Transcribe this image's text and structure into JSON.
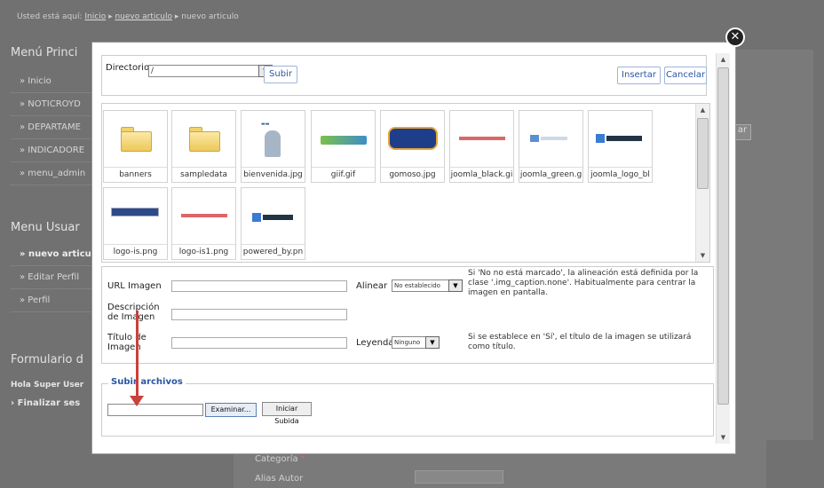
{
  "breadcrumb": {
    "prefix": "Usted está aquí:",
    "items": [
      "Inicio",
      "nuevo articulo",
      "nuevo articulo"
    ]
  },
  "sidebar": {
    "menu_principal": {
      "title": "Menú Princi",
      "items": [
        "Inicio",
        "NOTICROYD",
        "DEPARTAME",
        "INDICADORE",
        "menu_admin"
      ]
    },
    "menu_usuario": {
      "title": "Menu Usuar",
      "items": [
        "nuevo articu",
        "Editar Perfil",
        "Perfil"
      ]
    },
    "formulario": {
      "title": "Formulario d",
      "greeting": "Hola Super User",
      "logout": "Finalizar ses"
    }
  },
  "background_form": {
    "categoria_label": "Categoría",
    "required_mark": "*",
    "alias_label": "Alias Autor",
    "button_partial": "ar"
  },
  "modal": {
    "close_icon": "close-icon",
    "toolbar": {
      "directorio_label": "Directorio",
      "directorio_value": "/",
      "subir_label": "Subir",
      "insertar_label": "Insertar",
      "cancelar_label": "Cancelar"
    },
    "files": [
      {
        "name": "banners",
        "type": "folder"
      },
      {
        "name": "sampledata",
        "type": "folder"
      },
      {
        "name": "bienvenida.jpg",
        "type": "image"
      },
      {
        "name": "giif.gif",
        "type": "image"
      },
      {
        "name": "gomoso.jpg",
        "type": "image"
      },
      {
        "name": "joomla_black.gi",
        "type": "image"
      },
      {
        "name": "joomla_green.g",
        "type": "image"
      },
      {
        "name": "joomla_logo_bl",
        "type": "image"
      },
      {
        "name": "logo-is.png",
        "type": "image"
      },
      {
        "name": "logo-is1.png",
        "type": "image"
      },
      {
        "name": "powered_by.pn",
        "type": "image"
      }
    ],
    "fields": {
      "url_label": "URL Imagen",
      "alinear_label": "Alinear",
      "alinear_value": "No establecido",
      "alinear_note": "Si 'No no está marcado', la alineación está definida por la clase '.img_caption.none'. Habitualmente para centrar la imagen en pantalla.",
      "descripcion_label": "Descripción de Imagen",
      "titulo_label": "Título de Imagen",
      "leyenda_label": "Leyenda",
      "leyenda_value": "Ninguno",
      "leyenda_note": "Si se establece en 'Sí', el título de la imagen se utilizará como título."
    },
    "upload": {
      "legend": "Subir archivos",
      "browse_label": "Examinar...",
      "start_label": "Iniciar Subida"
    }
  }
}
